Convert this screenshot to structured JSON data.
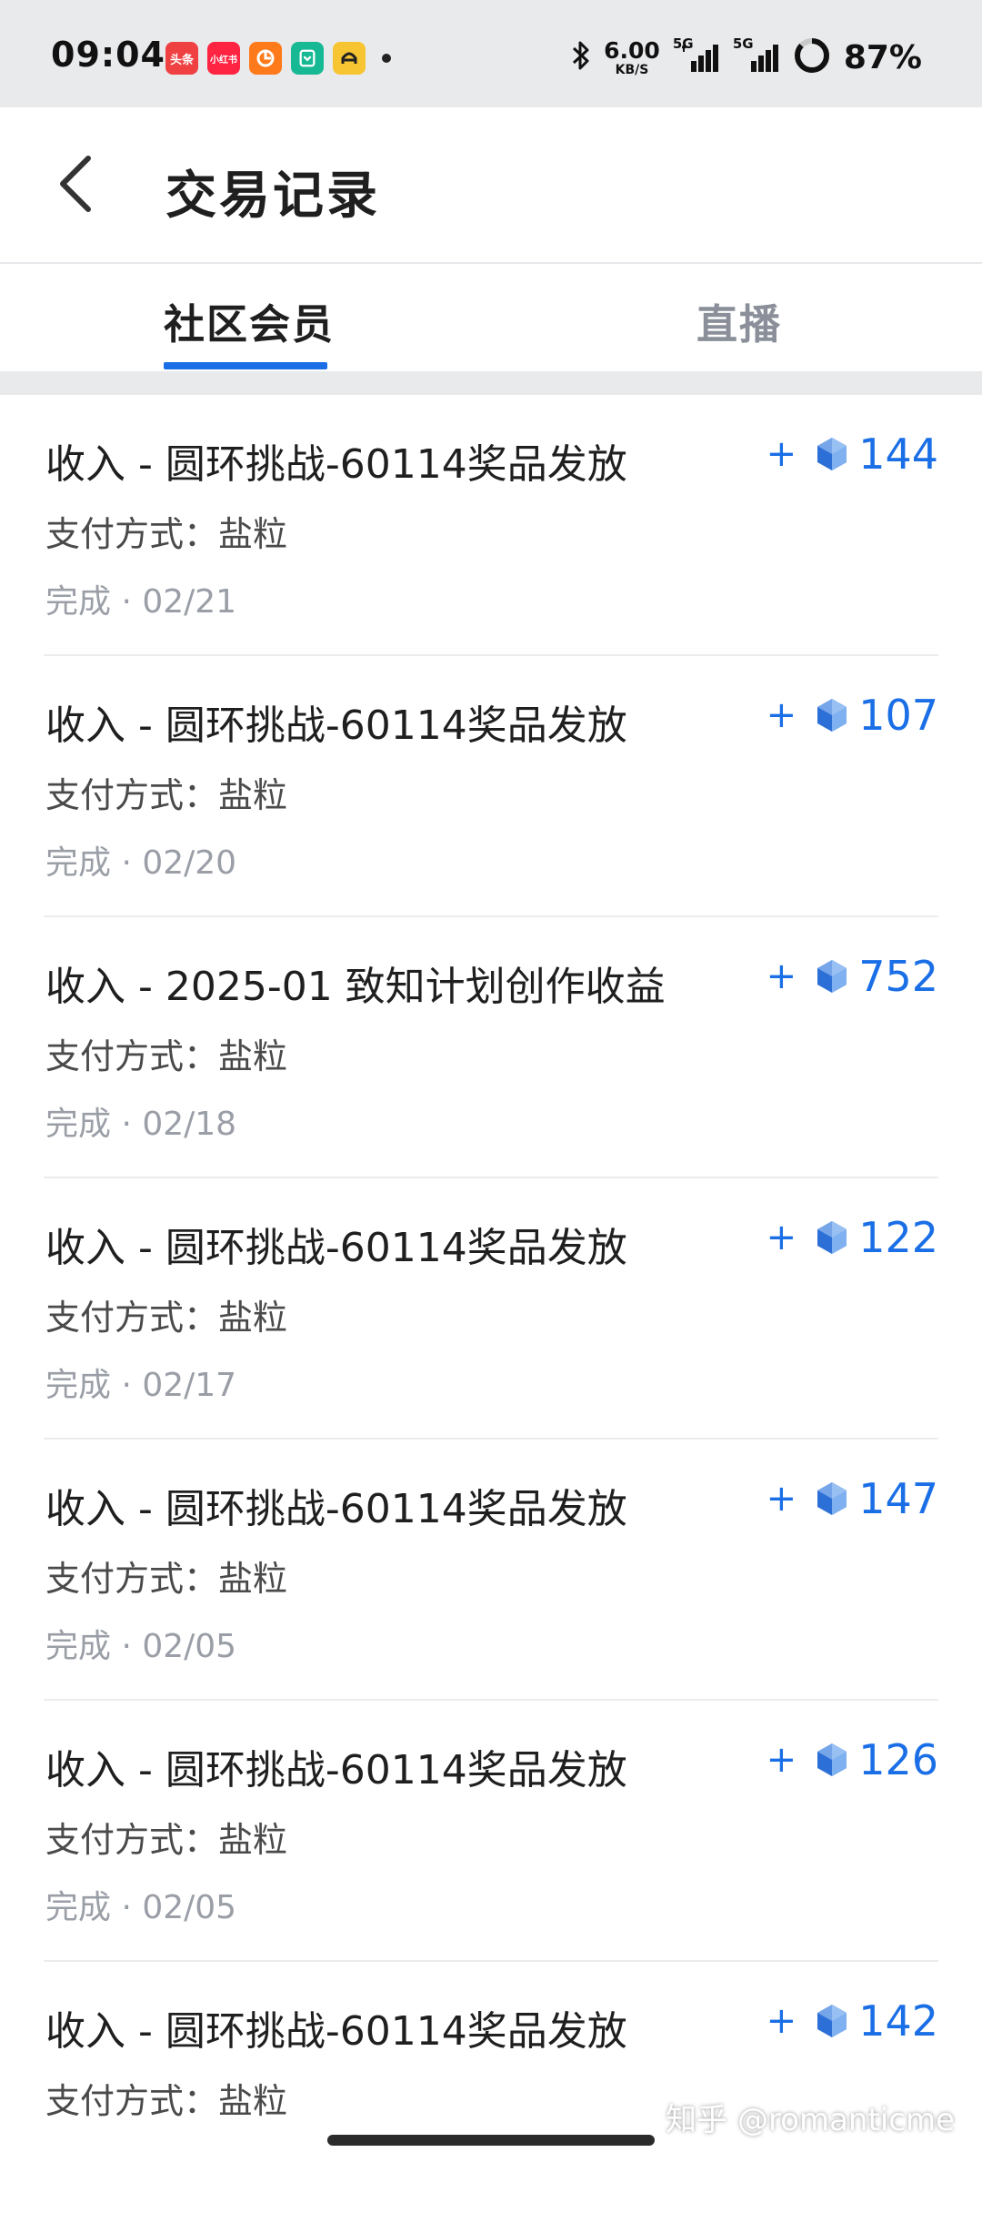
{
  "status_bar": {
    "time": "09:04",
    "app_icons": [
      {
        "label": "头条",
        "color": "#f04142"
      },
      {
        "label": "小红书",
        "color": "#ff2442"
      },
      {
        "label": "",
        "color": "#ff7a1a"
      },
      {
        "label": "",
        "color": "#17b894"
      },
      {
        "label": "",
        "color": "#f7c531"
      }
    ],
    "net_speed": "6.00",
    "net_unit": "KB/S",
    "signal_1_label": "5G",
    "signal_2_label": "5G",
    "battery": "87%"
  },
  "header": {
    "title": "交易记录"
  },
  "tabs": [
    {
      "label": "社区会员",
      "active": true
    },
    {
      "label": "直播",
      "active": false
    }
  ],
  "transactions": [
    {
      "title": "收入 - 圆环挑战-60114奖品发放",
      "method": "支付方式：盐粒",
      "status": "完成 · 02/21",
      "sign": "+",
      "amount": "144"
    },
    {
      "title": "收入 - 圆环挑战-60114奖品发放",
      "method": "支付方式：盐粒",
      "status": "完成 · 02/20",
      "sign": "+",
      "amount": "107"
    },
    {
      "title": "收入 - 2025-01 致知计划创作收益",
      "method": "支付方式：盐粒",
      "status": "完成 · 02/18",
      "sign": "+",
      "amount": "752"
    },
    {
      "title": "收入 - 圆环挑战-60114奖品发放",
      "method": "支付方式：盐粒",
      "status": "完成 · 02/17",
      "sign": "+",
      "amount": "122"
    },
    {
      "title": "收入 - 圆环挑战-60114奖品发放",
      "method": "支付方式：盐粒",
      "status": "完成 · 02/05",
      "sign": "+",
      "amount": "147"
    },
    {
      "title": "收入 - 圆环挑战-60114奖品发放",
      "method": "支付方式：盐粒",
      "status": "完成 · 02/05",
      "sign": "+",
      "amount": "126"
    },
    {
      "title": "收入 - 圆环挑战-60114奖品发放",
      "method": "支付方式：盐粒",
      "status": "",
      "sign": "+",
      "amount": "142"
    }
  ],
  "watermark": "知乎 @romanticme",
  "colors": {
    "accent": "#1a6ee6",
    "status_bar_bg": "#e9eaec",
    "muted_text": "#9a9ea6"
  },
  "icons": {
    "back": "chevron-left-icon",
    "coin": "salt-coin-icon",
    "bluetooth": "bluetooth-icon",
    "battery": "battery-ring-icon"
  }
}
